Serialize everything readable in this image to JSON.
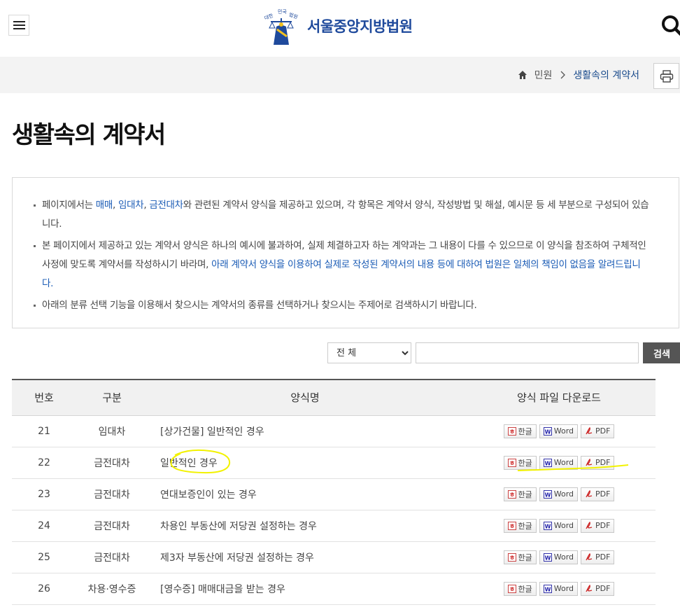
{
  "header": {
    "court_name": "서울중앙지방법원",
    "logo_caption": "대한민국법원"
  },
  "breadcrumb": {
    "items": [
      "민원",
      "생활속의 계약서"
    ]
  },
  "page": {
    "title": "생활속의 계약서"
  },
  "notice": {
    "item1": {
      "t1": "페이지에서는 ",
      "l1": "매매",
      "t2": ", ",
      "l2": "임대차",
      "t3": ", ",
      "l3": "금전대차",
      "t4": "와 관련된 계약서 양식을 제공하고 있으며, 각 항목은 계약서 양식, 작성방법 및 해설, 예시문 등 세 부분으로 구성되어 있습니다."
    },
    "item2": {
      "t1": "본 페이지에서 제공하고 있는 계약서 양식은 하나의 예시에 불과하여, 실제 체결하고자 하는 계약과는 그 내용이 다를 수 있으므로 이 양식을 참조하여 구체적인 사정에 맞도록 계약서를 작성하시기 바라며, ",
      "l1": "아래 계약서 양식을 이용하여 실제로 작성된 계약서의 내용 등에 대하여 법원은 일체의 책임이 없음을 알려드립니다."
    },
    "item3": "아래의 분류 선택 기능을 이용해서 찾으시는 계약서의 종류를 선택하거나 찾으시는 주제어로 검색하시기 바랍니다."
  },
  "search": {
    "selected": "전 체",
    "button_label": "검색"
  },
  "table": {
    "headers": [
      "번호",
      "구분",
      "양식명",
      "양식 파일 다운로드"
    ],
    "download_labels": {
      "hwp": "한글",
      "word": "Word",
      "pdf": "PDF"
    },
    "rows": [
      {
        "num": "21",
        "category": "임대차",
        "name": "[상가건물] 일반적인 경우"
      },
      {
        "num": "22",
        "category": "금전대차",
        "name": "일반적인 경우"
      },
      {
        "num": "23",
        "category": "금전대차",
        "name": "연대보증인이 있는 경우"
      },
      {
        "num": "24",
        "category": "금전대차",
        "name": "차용인 부동산에 저당권 설정하는 경우"
      },
      {
        "num": "25",
        "category": "금전대차",
        "name": "제3자 부동산에 저당권 설정하는 경우"
      },
      {
        "num": "26",
        "category": "차용·영수증",
        "name": "[영수증] 매매대금을 받는 경우"
      }
    ]
  },
  "colors": {
    "brand_blue": "#1f4a9c",
    "link_blue": "#1a5bb5",
    "highlight": "#f2f200"
  }
}
